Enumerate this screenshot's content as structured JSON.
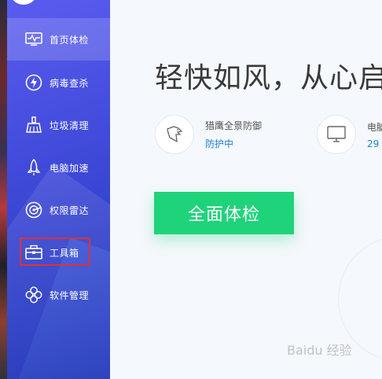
{
  "sidebar": {
    "items": [
      {
        "label": "首页体检",
        "icon": "monitor-pulse-icon"
      },
      {
        "label": "病毒查杀",
        "icon": "lightning-circle-icon"
      },
      {
        "label": "垃圾清理",
        "icon": "broom-icon"
      },
      {
        "label": "电脑加速",
        "icon": "rocket-icon"
      },
      {
        "label": "权限雷达",
        "icon": "radar-icon"
      },
      {
        "label": "工具箱",
        "icon": "toolbox-icon"
      },
      {
        "label": "软件管理",
        "icon": "clover-icon"
      }
    ],
    "active_index": 0,
    "highlighted_index": 5
  },
  "main": {
    "slogan": "轻快如风，从心启",
    "status": [
      {
        "title": "猎鹰全景防御",
        "value": "防护中",
        "icon": "eagle-icon"
      },
      {
        "title": "电脑",
        "value": "29",
        "icon": "monitor-icon"
      }
    ],
    "check_button": "全面体检"
  },
  "watermark": "Baidu 经验",
  "colors": {
    "sidebar": "#3f49d8",
    "accent_green": "#1fd37a",
    "status_blue": "#1f7fd6",
    "highlight_red": "#e0303a"
  }
}
